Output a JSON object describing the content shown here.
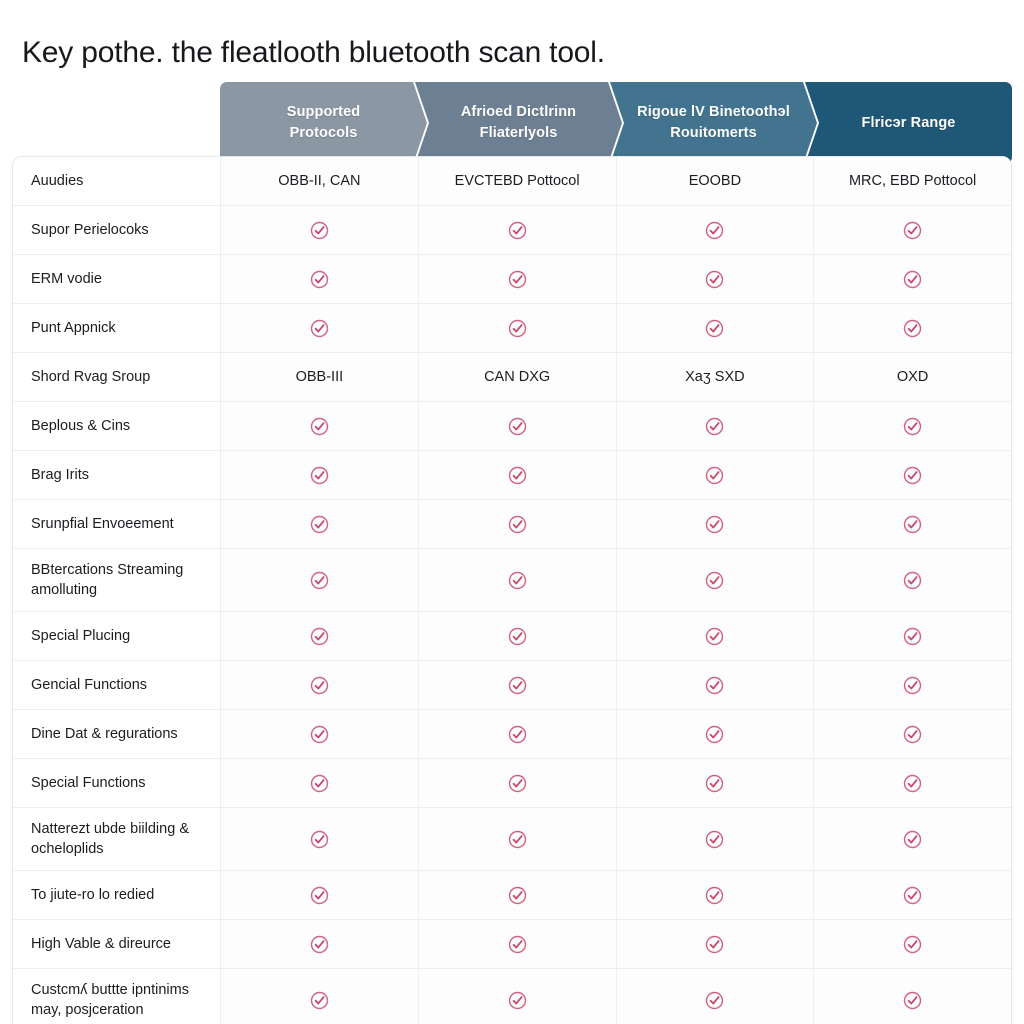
{
  "page": {
    "title": "Key pothe. the fleatlooth bluetooth scan tool."
  },
  "table": {
    "columns": [
      {
        "id": "col-1",
        "label_line1": "Supported",
        "label_line2": "Protocols",
        "color": "#8b97a3"
      },
      {
        "id": "col-2",
        "label_line1": "Afrioed Dictlrinn",
        "label_line2": "Fliaterlyols",
        "color": "#6d8093"
      },
      {
        "id": "col-3",
        "label_line1": "Rigoue lV Binetoothэl",
        "label_line2": "Rouitomerts",
        "color": "#43748f"
      },
      {
        "id": "col-4",
        "label_line1": "Flricэr Range",
        "label_line2": "",
        "color": "#1f5777"
      }
    ],
    "check_icon": "check-circle-icon",
    "check_color": "#c8486b",
    "rows": [
      {
        "label": "Auudies",
        "lines": 1,
        "cells": [
          "OBB-II, CAN",
          "EVCTEBD Pottocol",
          "EOOBD",
          "MRC, EBD Pottocol"
        ]
      },
      {
        "label": "Supor Perielocoks",
        "lines": 1,
        "cells": [
          "check",
          "check",
          "check",
          "check"
        ]
      },
      {
        "label": "ERM vodie",
        "lines": 1,
        "cells": [
          "check",
          "check",
          "check",
          "check"
        ]
      },
      {
        "label": "Punt Appnick",
        "lines": 1,
        "cells": [
          "check",
          "check",
          "check",
          "check"
        ]
      },
      {
        "label": "Shord Rvag Sroup",
        "lines": 1,
        "cells": [
          "OBB-III",
          "CAN DXG",
          "Xaʒ SXD",
          "OXD"
        ]
      },
      {
        "label": "Beplous & Cins",
        "lines": 1,
        "cells": [
          "check",
          "check",
          "check",
          "check"
        ]
      },
      {
        "label": "Brag Irits",
        "lines": 1,
        "cells": [
          "check",
          "check",
          "check",
          "check"
        ]
      },
      {
        "label": "Srunpfial Envoeement",
        "lines": 1,
        "cells": [
          "check",
          "check",
          "check",
          "check"
        ]
      },
      {
        "label": "BBterсations Streaming amolluting",
        "lines": 2,
        "cells": [
          "check",
          "check",
          "check",
          "check"
        ]
      },
      {
        "label": "Special Plucing",
        "lines": 1,
        "cells": [
          "check",
          "check",
          "check",
          "check"
        ]
      },
      {
        "label": "Gencial Functions",
        "lines": 1,
        "cells": [
          "check",
          "check",
          "check",
          "check"
        ]
      },
      {
        "label": "Dine Dat & regurations",
        "lines": 1,
        "cells": [
          "check",
          "check",
          "check",
          "check"
        ]
      },
      {
        "label": "Special Functions",
        "lines": 1,
        "cells": [
          "check",
          "check",
          "check",
          "check"
        ]
      },
      {
        "label": "Natterezt ubde biilding & ocheloplids",
        "lines": 2,
        "cells": [
          "check",
          "check",
          "check",
          "check"
        ]
      },
      {
        "label": "To jiute-ro lo redied",
        "lines": 1,
        "cells": [
          "check",
          "check",
          "check",
          "check"
        ]
      },
      {
        "label": "High Vable & direurce",
        "lines": 1,
        "cells": [
          "check",
          "check",
          "check",
          "check"
        ]
      },
      {
        "label": "Custcmʎ buttte ipntinims may, posjceration",
        "lines": 2,
        "cells": [
          "check",
          "check",
          "check",
          "check"
        ]
      }
    ]
  }
}
